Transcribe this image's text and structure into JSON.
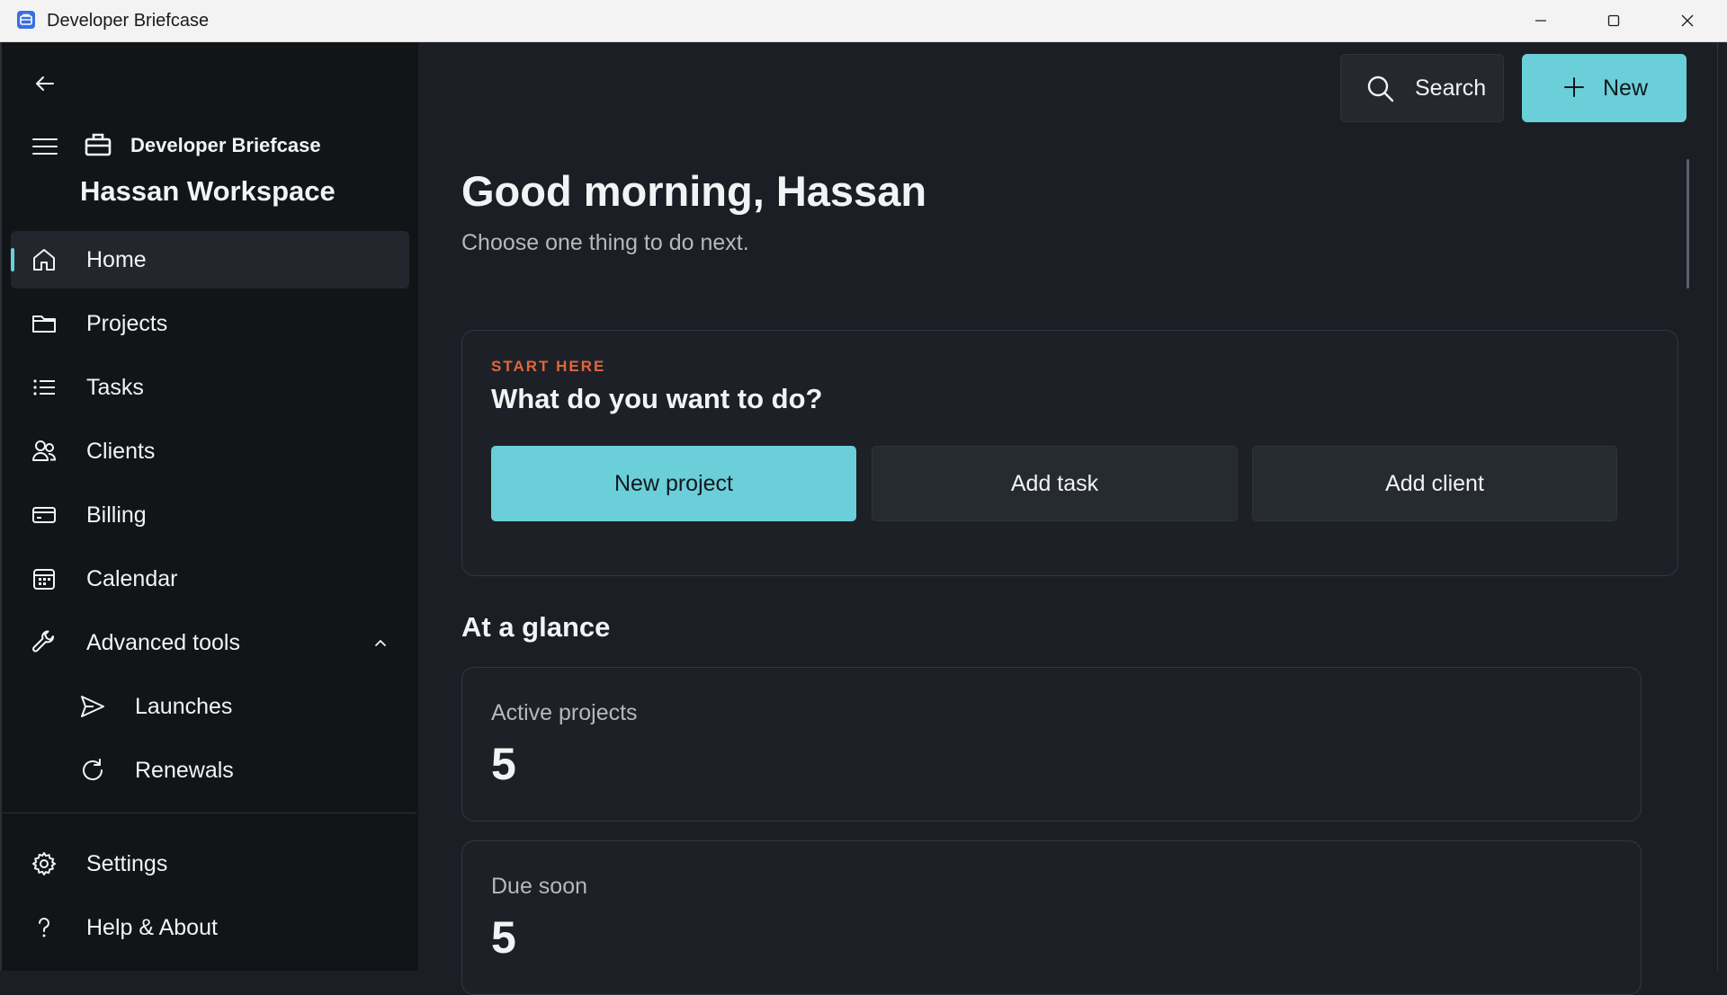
{
  "window": {
    "title": "Developer Briefcase"
  },
  "sidebar": {
    "app_name": "Developer Briefcase",
    "workspace": "Hassan Workspace",
    "items": [
      {
        "label": "Home",
        "icon": "home-icon",
        "active": true
      },
      {
        "label": "Projects",
        "icon": "folder-icon"
      },
      {
        "label": "Tasks",
        "icon": "list-icon"
      },
      {
        "label": "Clients",
        "icon": "people-icon"
      },
      {
        "label": "Billing",
        "icon": "credit-card-icon"
      },
      {
        "label": "Calendar",
        "icon": "calendar-icon"
      },
      {
        "label": "Advanced tools",
        "icon": "wrench-icon",
        "expanded": true
      }
    ],
    "subitems": [
      {
        "label": "Launches",
        "icon": "send-icon"
      },
      {
        "label": "Renewals",
        "icon": "refresh-icon"
      }
    ],
    "footer": [
      {
        "label": "Settings",
        "icon": "gear-icon"
      },
      {
        "label": "Help & About",
        "icon": "question-icon"
      }
    ]
  },
  "header": {
    "search_label": "Search",
    "new_label": "New"
  },
  "main": {
    "greeting": "Good morning, Hassan",
    "subtitle": "Choose one thing to do next.",
    "start_card": {
      "eyebrow": "START HERE",
      "title": "What do you want to do?",
      "actions": [
        "New project",
        "Add task",
        "Add client"
      ]
    },
    "glance_title": "At a glance",
    "stats": [
      {
        "label": "Active projects",
        "value": "5"
      },
      {
        "label": "Due soon",
        "value": "5"
      }
    ]
  },
  "colors": {
    "accent": "#6bcfd9",
    "eyebrow": "#e0673a",
    "sidebar_bg": "#121417",
    "main_bg": "#1b1e24"
  }
}
